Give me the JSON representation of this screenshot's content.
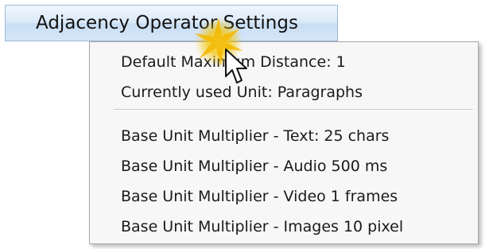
{
  "menu_button": {
    "label": "Adjacency Operator Settings"
  },
  "dropdown": {
    "items": [
      {
        "label": "Default Maximum Distance: 1"
      },
      {
        "label": "Currently used Unit: Paragraphs"
      },
      {
        "label": "Base Unit Multiplier - Text: 25 chars"
      },
      {
        "label": "Base Unit Multiplier - Audio 500 ms"
      },
      {
        "label": "Base Unit Multiplier - Video 1 frames"
      },
      {
        "label": "Base Unit Multiplier - Images 10 pixel"
      }
    ]
  },
  "colors": {
    "button_bg_top": "#f0f7ff",
    "button_bg_bottom": "#c9ddf3",
    "button_border": "#9fb9d6",
    "menu_bg": "#f7f7f7",
    "click_highlight": "#f5c400"
  },
  "icons": {
    "cursor": "arrow-pointer-icon",
    "click_highlight": "click-burst-icon"
  }
}
